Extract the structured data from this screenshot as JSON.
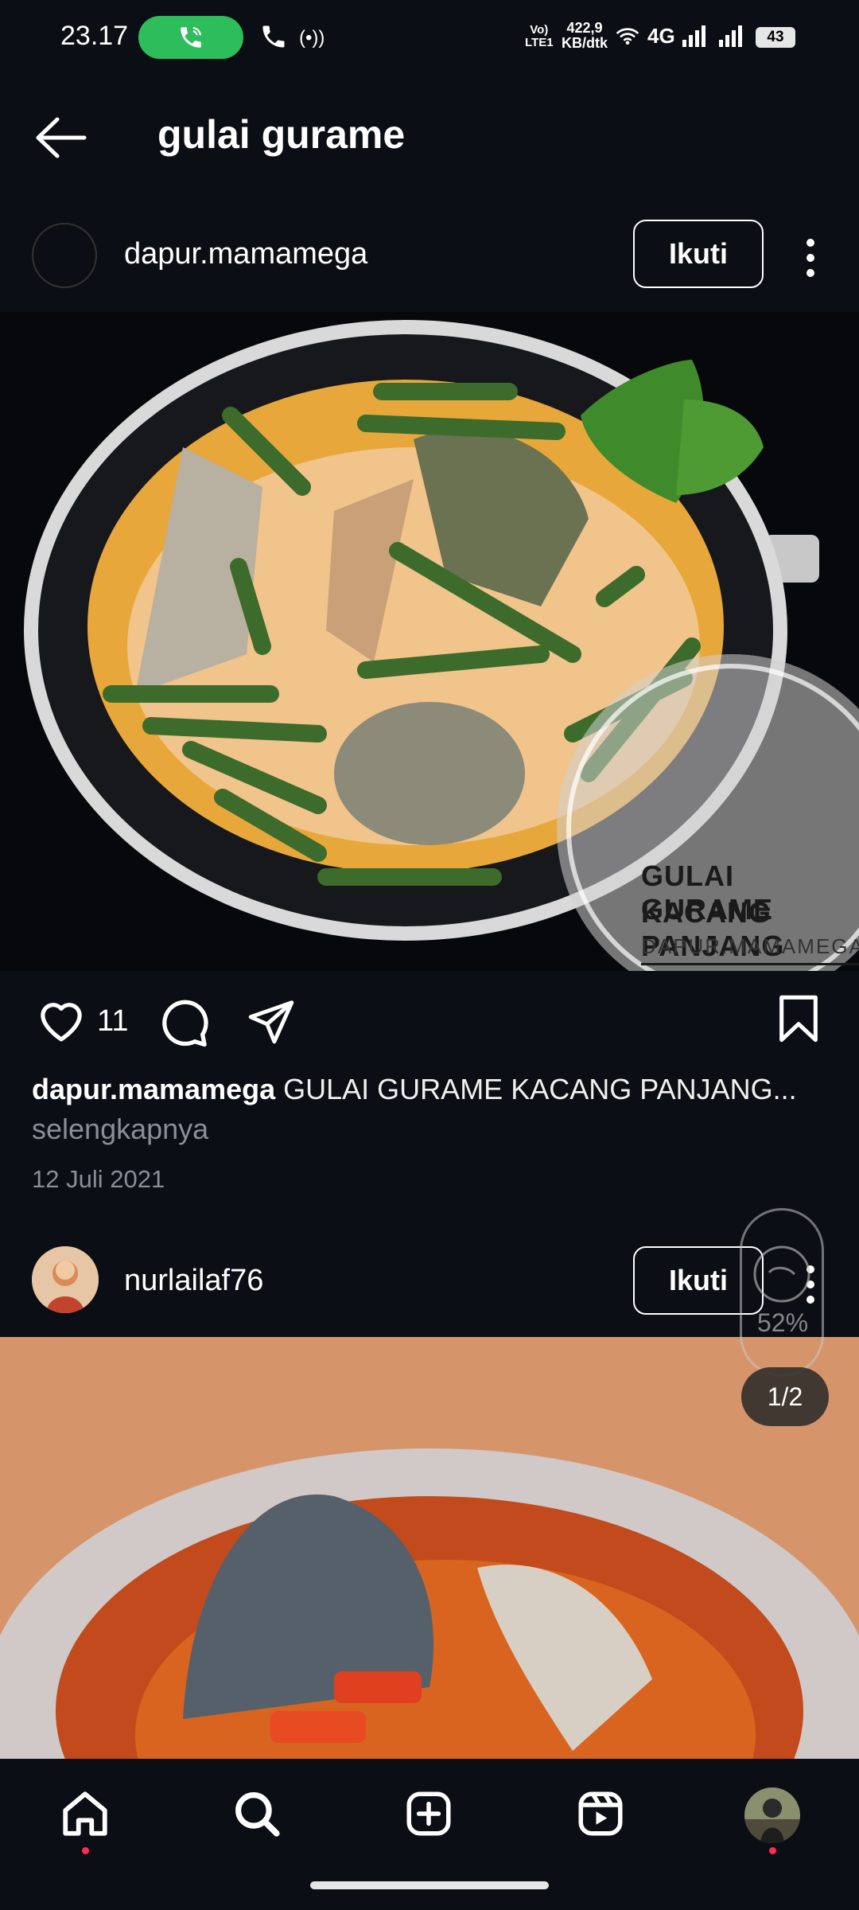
{
  "status_bar": {
    "time": "23.17",
    "volte_top": "Vo)",
    "volte_bottom": "LTE1",
    "speed_value": "422,9",
    "speed_unit": "KB/dtk",
    "network": "4G",
    "battery": "43"
  },
  "header": {
    "title": "gulai gurame"
  },
  "post1": {
    "username": "dapur.mamamega",
    "follow_label": "Ikuti",
    "image_overlay_line1": "GULAI GURAME",
    "image_overlay_line2": "KACANG PANJANG",
    "image_overlay_line3": "DAPUR.MAMAMEGA",
    "likes": "11",
    "caption_user": "dapur.mamamega",
    "caption_text": "GULAI GURAME KACANG PANJANG...",
    "more_label": "selengkapnya",
    "date": "12 Juli 2021"
  },
  "post2": {
    "username": "nurlailaf76",
    "follow_label": "Ikuti",
    "page_indicator": "1/2"
  },
  "floating_widget": {
    "percent": "52%"
  },
  "bottom_nav": {
    "items": [
      "home-icon",
      "search-icon",
      "create-icon",
      "reels-icon",
      "profile-avatar"
    ]
  },
  "colors": {
    "background": "#0b0e14",
    "call_pill": "#2dbd5a",
    "notification_dot": "#ff2d55",
    "secondary_text": "#8a8e96"
  }
}
